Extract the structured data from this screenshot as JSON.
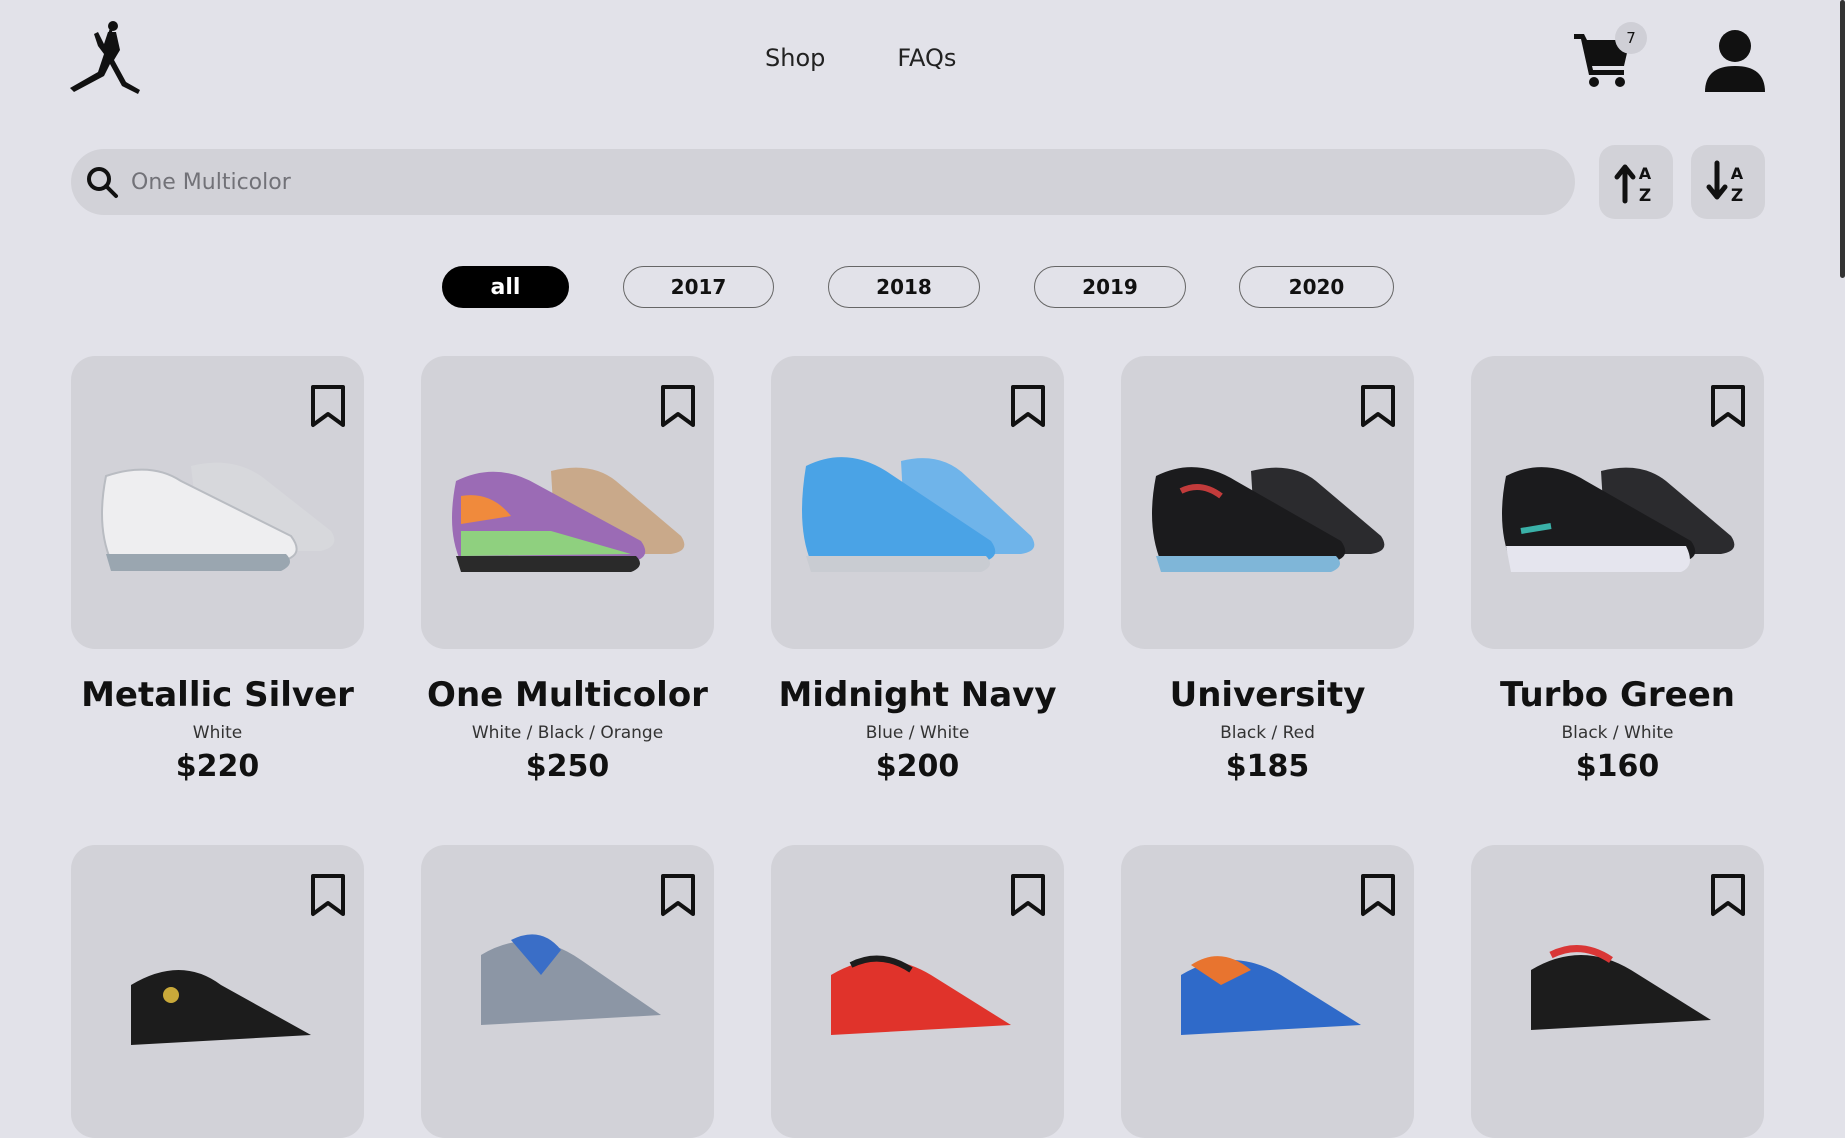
{
  "nav": {
    "shop": "Shop",
    "faqs": "FAQs"
  },
  "cart": {
    "count": "7"
  },
  "search": {
    "placeholder": "One Multicolor"
  },
  "filters": [
    "all",
    "2017",
    "2018",
    "2019",
    "2020"
  ],
  "products": [
    {
      "name": "Metallic Silver",
      "colors": "White",
      "price": "$220",
      "palette": [
        "#e8e8ea",
        "#bfc2c7",
        "#9aa6b0"
      ]
    },
    {
      "name": "One Multicolor",
      "colors": "White / Black / Orange",
      "price": "$250",
      "palette": [
        "#f08a3c",
        "#9b6bb5",
        "#8fd07f"
      ]
    },
    {
      "name": "Midnight Navy",
      "colors": "Blue / White",
      "price": "$200",
      "palette": [
        "#4aa3e6",
        "#7cc0f0",
        "#c9ccd2"
      ]
    },
    {
      "name": "University",
      "colors": "Black / Red",
      "price": "$185",
      "palette": [
        "#1b1b1d",
        "#c23b3b",
        "#7fb6d8"
      ]
    },
    {
      "name": "Turbo Green",
      "colors": "Black / White",
      "price": "$160",
      "palette": [
        "#1b1b1d",
        "#3ab1a8",
        "#e5e5ee"
      ]
    }
  ],
  "row2": [
    {
      "palette": [
        "#1c1c1c",
        "#c9a93a"
      ]
    },
    {
      "palette": [
        "#3a6ec7",
        "#8c96a5"
      ]
    },
    {
      "palette": [
        "#e0332b",
        "#1c1c1c"
      ]
    },
    {
      "palette": [
        "#e8742f",
        "#2f6ac9"
      ]
    },
    {
      "palette": [
        "#1c1c1c",
        "#d93636"
      ]
    }
  ]
}
